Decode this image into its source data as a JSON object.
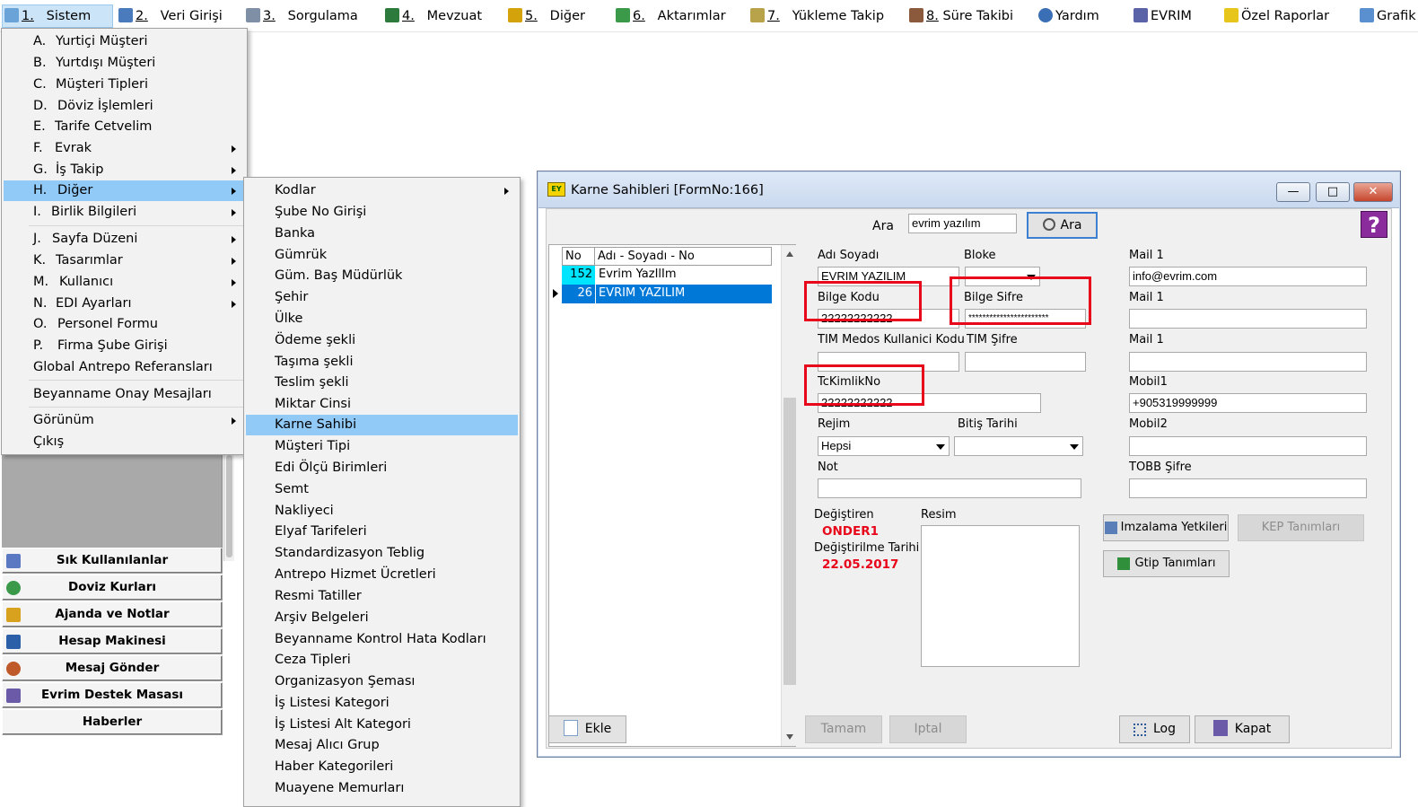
{
  "menubar": {
    "items": [
      {
        "num": "1.",
        "label": "Sistem"
      },
      {
        "num": "2.",
        "label": "Veri Girişi"
      },
      {
        "num": "3.",
        "label": "Sorgulama"
      },
      {
        "num": "4.",
        "label": "Mevzuat"
      },
      {
        "num": "5.",
        "label": "Diğer"
      },
      {
        "num": "6.",
        "label": "Aktarımlar"
      },
      {
        "num": "7.",
        "label": "Yükleme Takip"
      },
      {
        "num": "8.",
        "label": "Süre Takibi"
      },
      {
        "num": "",
        "label": "Yardım"
      },
      {
        "num": "",
        "label": "EVRIM"
      },
      {
        "num": "",
        "label": "Özel Raporlar"
      },
      {
        "num": "",
        "label": "Grafik"
      }
    ]
  },
  "menu1": {
    "items": [
      {
        "key": "A.",
        "label": "Yurtiçi Müşteri"
      },
      {
        "key": "B.",
        "label": "Yurtdışı Müşteri"
      },
      {
        "key": "C.",
        "label": "Müşteri Tipleri"
      },
      {
        "key": "D.",
        "label": "Döviz İşlemleri"
      },
      {
        "key": "E.",
        "label": "Tarife Cetvelim"
      },
      {
        "key": "F.",
        "label": "Evrak"
      },
      {
        "key": "G.",
        "label": "İş Takip"
      },
      {
        "key": "H.",
        "label": "Diğer"
      },
      {
        "key": "I.",
        "label": "Birlik Bilgileri"
      },
      {
        "key": "J.",
        "label": "Sayfa Düzeni"
      },
      {
        "key": "K.",
        "label": "Tasarımlar"
      },
      {
        "key": "M.",
        "label": "Kullanıcı"
      },
      {
        "key": "N.",
        "label": "EDI Ayarları"
      },
      {
        "key": "O.",
        "label": "Personel Formu"
      },
      {
        "key": "P.",
        "label": "Firma Şube Girişi"
      },
      {
        "key": "",
        "label": "Global Antrepo Referansları"
      },
      {
        "key": "",
        "label": "Beyanname Onay Mesajları"
      },
      {
        "key": "",
        "label": "Görünüm"
      },
      {
        "key": "",
        "label": "Çıkış"
      }
    ]
  },
  "menu2": {
    "items": [
      "Kodlar",
      "Şube No Girişi",
      "Banka",
      "Gümrük",
      "Güm. Baş Müdürlük",
      "Şehir",
      "Ülke",
      "Ödeme şekli",
      "Taşıma şekli",
      "Teslim şekli",
      "Miktar Cinsi",
      "Karne Sahibi",
      "Müşteri  Tipi",
      "Edi Ölçü Birimleri",
      "Semt",
      "Nakliyeci",
      "Elyaf Tarifeleri",
      "Standardizasyon Teblig",
      "Antrepo Hizmet Ücretleri",
      "Resmi Tatiller",
      "Arşiv Belgeleri",
      "Beyanname Kontrol Hata Kodları",
      "Ceza Tipleri",
      "Organizasyon Şeması",
      "İş Listesi Kategori",
      "İş Listesi Alt Kategori",
      "Mesaj Alıcı Grup",
      "Haber Kategorileri",
      "Muayene Memurları"
    ]
  },
  "shortcuts": [
    "Sık Kullanılanlar",
    "Doviz Kurları",
    "Ajanda ve Notlar",
    "Hesap Makinesi",
    "Mesaj Gönder",
    "Evrim Destek Masası",
    "Haberler"
  ],
  "window": {
    "title": "Karne Sahibleri [FormNo:166]",
    "search_label": "Ara",
    "search_value": "evrim yazılım",
    "search_button": "Ara",
    "help": "?",
    "grid": {
      "headers": [
        "No",
        "Adı - Soyadı - No"
      ],
      "rows": [
        {
          "no": "152",
          "name": "Evrim YazIlIm"
        },
        {
          "no": "26",
          "name": "EVRIM YAZILIM"
        }
      ]
    },
    "fields": {
      "adi_soyadi_label": "Adı Soyadı",
      "adi_soyadi_value": "EVRIM YAZILIM",
      "bloke_label": "Bloke",
      "bilge_kodu_label": "Bilge Kodu",
      "bilge_kodu_value": "22222222222",
      "bilge_sifre_label": "Bilge Sifre",
      "bilge_sifre_value": "***********************",
      "tim_kodu_label": "TIM Medos Kullanici Kodu",
      "tim_sifre_label": "TIM Şifre",
      "tckimlik_label": "TcKimlikNo",
      "tckimlik_value": "22222222222",
      "rejim_label": "Rejim",
      "rejim_value": "Hepsi",
      "bitis_label": "Bitiş Tarihi",
      "not_label": "Not",
      "mail1a_label": "Mail 1",
      "mail1a_value": "info@evrim.com",
      "mail1b_label": "Mail 1",
      "mail1c_label": "Mail 1",
      "mobil1_label": "Mobil1",
      "mobil1_value": "+905319999999",
      "mobil2_label": "Mobil2",
      "tobb_label": "TOBB Şifre",
      "degistiren_label": "Değiştiren",
      "degistiren_value": "ONDER1",
      "degistirilme_label": "Değiştirilme Tarihi",
      "degistirilme_value": "22.05.2017",
      "resim_label": "Resim"
    },
    "buttons": {
      "imzalama": "Imzalama Yetkileri",
      "kep": "KEP Tanımları",
      "gtip": "Gtip Tanımları",
      "ekle": "Ekle",
      "tamam": "Tamam",
      "iptal": "Iptal",
      "log": "Log",
      "kapat": "Kapat"
    }
  },
  "colors": {
    "menu_highlight": "#91c9f7",
    "selected_row": "#0078d7",
    "no_cell": "#00e5ff",
    "annotation_red": "#e8061a"
  }
}
